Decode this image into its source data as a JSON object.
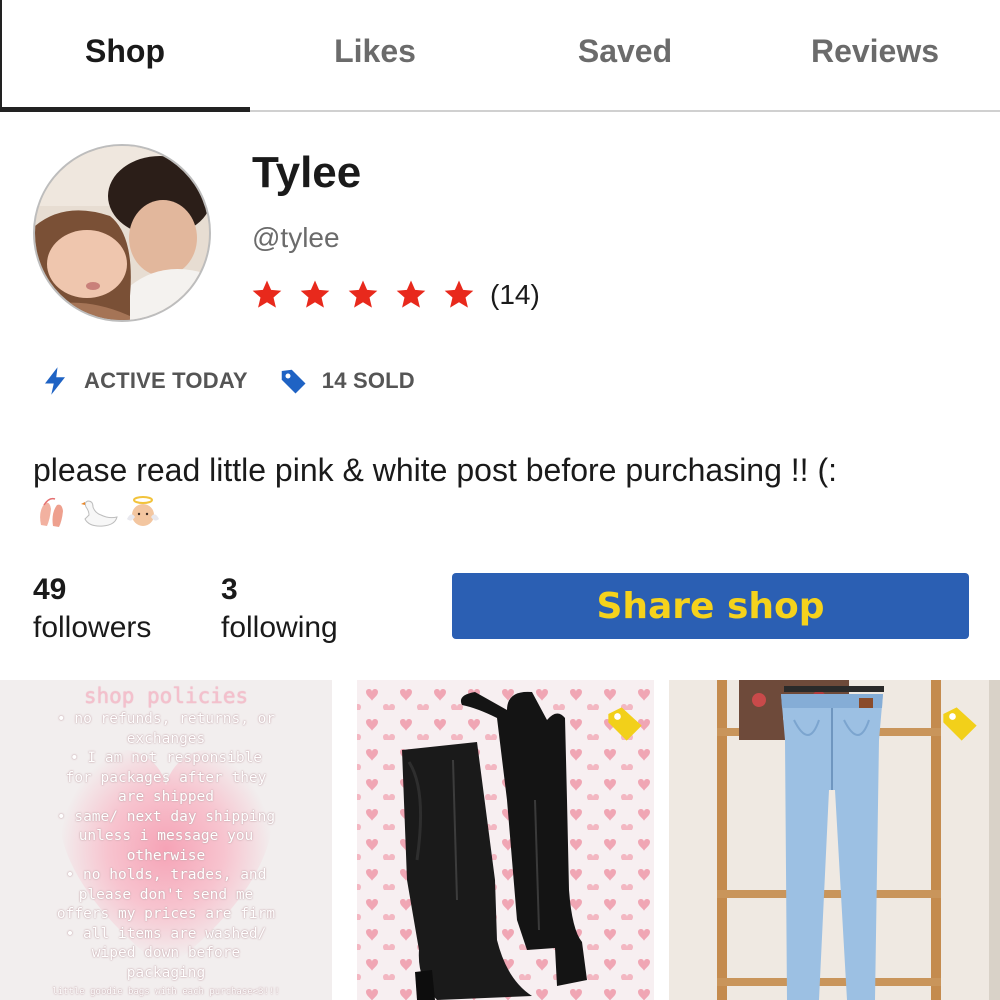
{
  "tabs": [
    {
      "label": "Shop",
      "active": true
    },
    {
      "label": "Likes",
      "active": false
    },
    {
      "label": "Saved",
      "active": false
    },
    {
      "label": "Reviews",
      "active": false
    }
  ],
  "profile": {
    "name": "Tylee",
    "handle": "@tylee",
    "rating": 5,
    "review_count": "(14)",
    "avatar_icon": "profile-photo"
  },
  "badges": {
    "active": {
      "label": "ACTIVE TODAY",
      "icon": "lightning-icon"
    },
    "sold": {
      "label": "14 SOLD",
      "icon": "tag-icon"
    }
  },
  "bio": {
    "text": "please read little pink & white post before purchasing !! (:",
    "emojis": [
      "ballet-shoes",
      "swan",
      "baby-angel"
    ]
  },
  "stats": {
    "followers_count": "49",
    "followers_label": "followers",
    "following_count": "3",
    "following_label": "following"
  },
  "share_button": {
    "label": "Share shop"
  },
  "colors": {
    "accent_blue": "#2b5fb3",
    "share_text_yellow": "#f5d21c",
    "star_red": "#e8291c",
    "badge_blue": "#1f63c4",
    "tag_yellow": "#f2d01a"
  },
  "listings": [
    {
      "type": "policy-post",
      "title": "shop policies",
      "lines": [
        "• no refunds, returns, or",
        "exchanges",
        "• I am not responsible",
        "for packages after they",
        "are shipped",
        "• same/ next day shipping",
        "unless i message you",
        "otherwise",
        "• no holds, trades, and",
        "please don't send me",
        "offers my prices are firm",
        "• all items are washed/",
        "wiped down before",
        "packaging"
      ],
      "footer": "little goodie bags with each purchase<3!!!"
    },
    {
      "type": "product",
      "image": "black-platform-knee-boots",
      "tagged": true
    },
    {
      "type": "product",
      "image": "light-wash-jeans",
      "tagged": true
    }
  ]
}
